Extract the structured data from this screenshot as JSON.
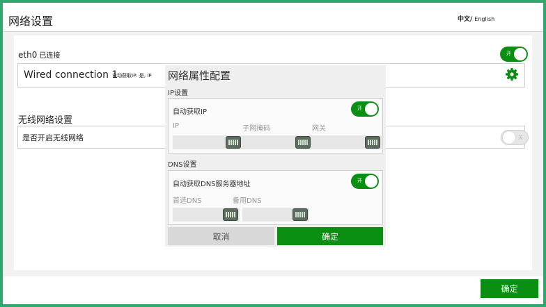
{
  "header": {
    "title": "网络设置",
    "lang_cn": "中文/",
    "lang_en": "English"
  },
  "eth": {
    "name": "eth0",
    "status": "已连接",
    "toggle_label": "开",
    "connection_name": "Wired connection 1",
    "connection_detail": "自动获取IP: 是, IP"
  },
  "wifi": {
    "section_title": "无线网络设置",
    "enable_label": "是否开启无线网络",
    "toggle_label": "关"
  },
  "dialog": {
    "title": "网络属性配置",
    "ip_section": "IP设置",
    "auto_ip_label": "自动获取IP",
    "auto_ip_toggle": "开",
    "ip_label": "IP",
    "mask_label": "子网掩码",
    "gateway_label": "网关",
    "dns_section": "DNS设置",
    "auto_dns_label": "自动获取DNS服务器地址",
    "auto_dns_toggle": "开",
    "primary_dns_label": "首选DNS",
    "secondary_dns_label": "备用DNS",
    "cancel_label": "取消",
    "ok_label": "确定"
  },
  "footer": {
    "confirm_label": "确定"
  },
  "colors": {
    "accent": "#0a8f12",
    "frame": "#2fa86e"
  },
  "icons": {
    "settings": "gear-icon",
    "keyboard": "keyboard-icon"
  }
}
